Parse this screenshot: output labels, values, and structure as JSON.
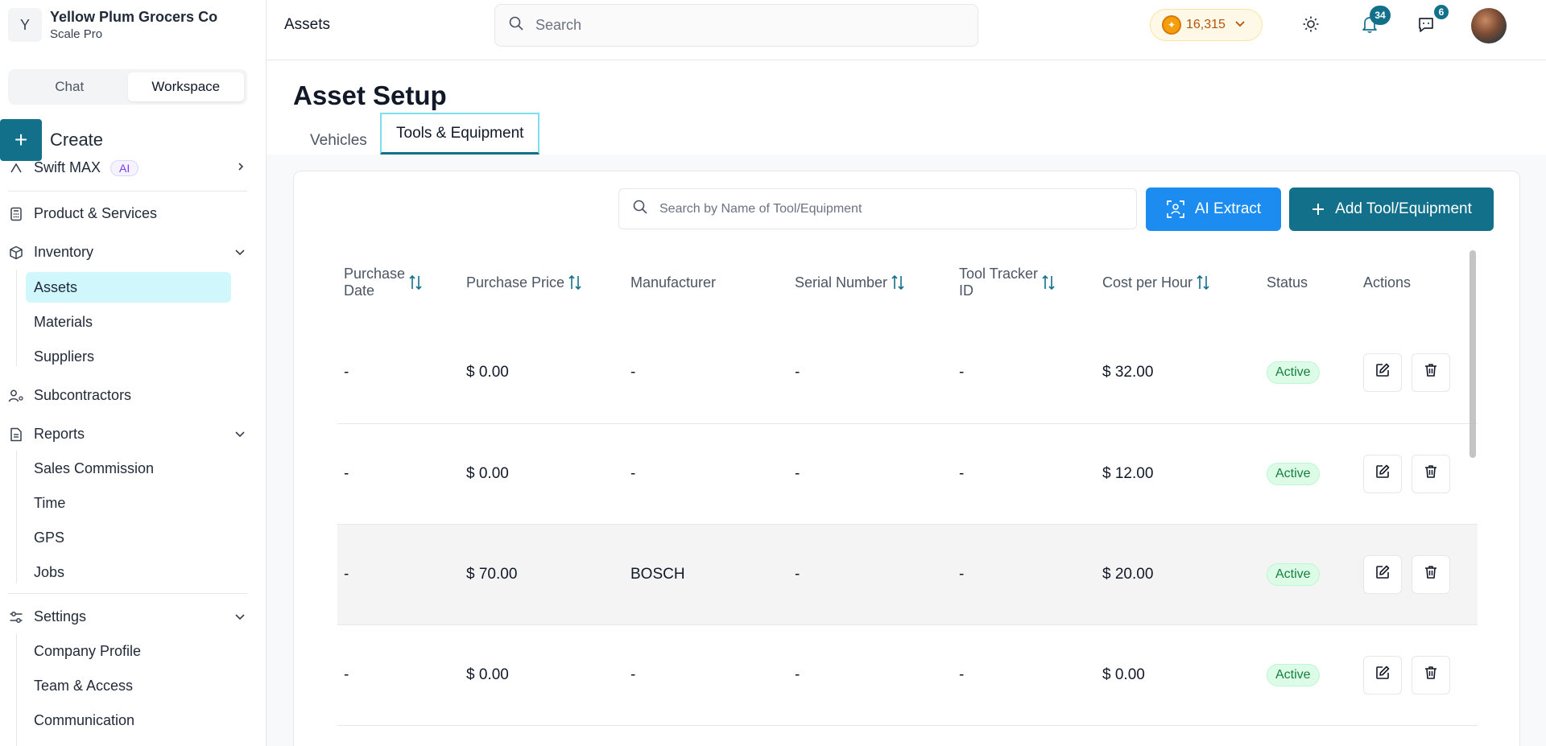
{
  "company": {
    "initial": "Y",
    "name": "Yellow Plum Grocers Co",
    "plan": "Scale Pro"
  },
  "switcher": {
    "chat": "Chat",
    "workspace": "Workspace"
  },
  "create_label": "Create",
  "sidebar": {
    "swift_label": "Swift MAX",
    "swift_badge": "AI",
    "product_services": "Product & Services",
    "inventory": "Inventory",
    "inventory_items": [
      "Assets",
      "Materials",
      "Suppliers"
    ],
    "subcontractors": "Subcontractors",
    "reports": "Reports",
    "report_items": [
      "Sales Commission",
      "Time",
      "GPS",
      "Jobs"
    ],
    "settings": "Settings",
    "settings_items": [
      "Company Profile",
      "Team & Access",
      "Communication"
    ]
  },
  "topbar": {
    "breadcrumb": "Assets",
    "search_placeholder": "Search",
    "credits": "16,315",
    "notifications_count": "34",
    "messages_count": "6"
  },
  "page": {
    "title": "Asset Setup",
    "tabs": [
      "Vehicles",
      "Tools & Equipment"
    ],
    "search_placeholder": "Search by Name of Tool/Equipment",
    "ai_extract": "AI Extract",
    "add_button": "Add Tool/Equipment"
  },
  "table": {
    "headers": {
      "purchase_date_1": "Purchase",
      "purchase_date_2": "Date",
      "purchase_price": "Purchase Price",
      "manufacturer": "Manufacturer",
      "serial_number": "Serial Number",
      "tracker_1": "Tool Tracker",
      "tracker_2": "ID",
      "cost_per_hour": "Cost per Hour",
      "status": "Status",
      "actions": "Actions"
    },
    "rows": [
      {
        "purchase_date": "-",
        "purchase_price": "$ 0.00",
        "manufacturer": "-",
        "serial_number": "-",
        "tracker_id": "-",
        "cost_per_hour": "$ 32.00",
        "status": "Active"
      },
      {
        "purchase_date": "-",
        "purchase_price": "$ 0.00",
        "manufacturer": "-",
        "serial_number": "-",
        "tracker_id": "-",
        "cost_per_hour": "$ 12.00",
        "status": "Active"
      },
      {
        "purchase_date": "-",
        "purchase_price": "$ 70.00",
        "manufacturer": "BOSCH",
        "serial_number": "-",
        "tracker_id": "-",
        "cost_per_hour": "$ 20.00",
        "status": "Active"
      },
      {
        "purchase_date": "-",
        "purchase_price": "$ 0.00",
        "manufacturer": "-",
        "serial_number": "-",
        "tracker_id": "-",
        "cost_per_hour": "$ 0.00",
        "status": "Active"
      }
    ]
  },
  "colors": {
    "accent": "#13708a",
    "ai_button": "#1d8cf0",
    "active_nav": "#cff7fc",
    "status_bg": "#dcfce7",
    "status_text": "#15803d"
  }
}
